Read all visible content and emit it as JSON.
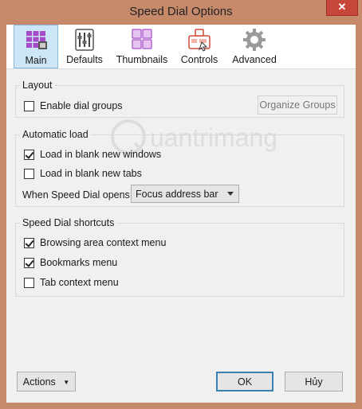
{
  "window": {
    "title": "Speed Dial Options",
    "close_glyph": "✕"
  },
  "tabs": [
    {
      "label": "Main",
      "icon": "grid-icon",
      "active": true
    },
    {
      "label": "Defaults",
      "icon": "sliders-icon"
    },
    {
      "label": "Thumbnails",
      "icon": "thumbnails-icon"
    },
    {
      "label": "Controls",
      "icon": "controls-icon"
    },
    {
      "label": "Advanced",
      "icon": "gear-icon"
    }
  ],
  "layout": {
    "legend": "Layout",
    "enable_dial_groups": {
      "label": "Enable dial groups",
      "checked": false
    },
    "organize_groups_label": "Organize Groups"
  },
  "automatic_load": {
    "legend": "Automatic load",
    "blank_windows": {
      "label": "Load in blank new windows",
      "checked": true
    },
    "blank_tabs": {
      "label": "Load in blank new tabs",
      "checked": false
    },
    "opens_label": "When Speed Dial opens:",
    "opens_value": "Focus address bar"
  },
  "shortcuts": {
    "legend": "Speed Dial shortcuts",
    "browsing_area": {
      "label": "Browsing area context menu",
      "checked": true
    },
    "bookmarks_menu": {
      "label": "Bookmarks menu",
      "checked": true
    },
    "tab_context": {
      "label": "Tab context menu",
      "checked": false
    }
  },
  "footer": {
    "actions_label": "Actions",
    "ok_label": "OK",
    "cancel_label": "Hủy"
  },
  "watermark": {
    "text": "uantrimang"
  },
  "colors": {
    "frame": "#c68a6b",
    "accent": "#3c7fb1",
    "tab_active": "#cde6f7"
  }
}
